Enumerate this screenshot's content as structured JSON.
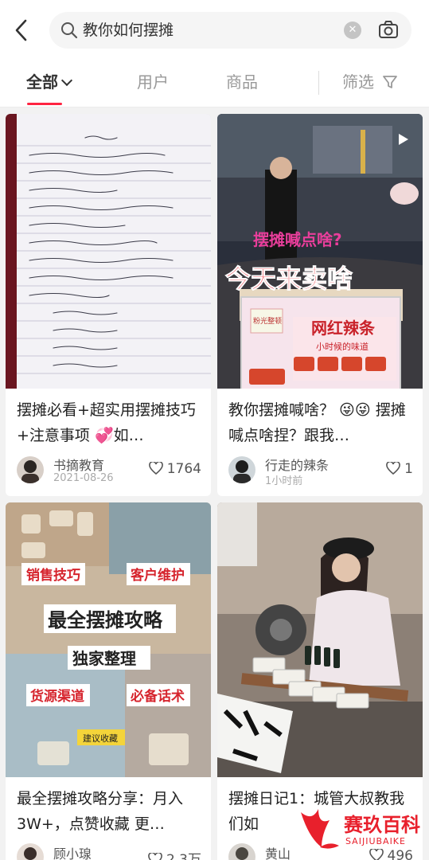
{
  "search": {
    "query": "教你如何摆摊",
    "clear_icon": "clear-circle-icon",
    "camera_icon": "camera-scan-icon"
  },
  "tabs": [
    {
      "label": "全部",
      "active": true
    },
    {
      "label": "用户",
      "active": false
    },
    {
      "label": "商品",
      "active": false
    },
    {
      "label": "筛选",
      "active": false
    }
  ],
  "posts": [
    {
      "title": "摆摊必看+超实用摆摊技巧+注意事项 💞如…",
      "author": "书摘教育",
      "time": "2021-08-26",
      "likes": "1764"
    },
    {
      "title": "教你摆摊喊啥？ 😜😜 摆摊喊点啥捏？跟我…",
      "author": "行走的辣条",
      "time": "1小时前",
      "likes": "1",
      "image_text": {
        "top": "摆摊喊点啥?",
        "bottom": "今天来卖啥",
        "sign": "网红辣条",
        "sign_sub": "小时候的味道",
        "sticker": "粉光整顿"
      }
    },
    {
      "title": "最全摆摊攻略分享：月入3W+，点赞收藏 更…",
      "author": "顾小瑔",
      "likes": "2.3万",
      "image_text": {
        "tag1": "销售技巧",
        "tag2": "客户维护",
        "main": "最全摆摊攻略",
        "sub": "独家整理",
        "tag3": "货源渠道",
        "tag4": "必备话术",
        "small": "建议收藏"
      }
    },
    {
      "title": "摆摊日记1：城管大叔教我们如",
      "author": "黄山",
      "likes": "496"
    }
  ],
  "watermark": {
    "name": "赛玖百科",
    "sub": "SAIJIUBAIKE"
  },
  "colors": {
    "accent": "#ff2442",
    "watermark": "#e8202c"
  }
}
